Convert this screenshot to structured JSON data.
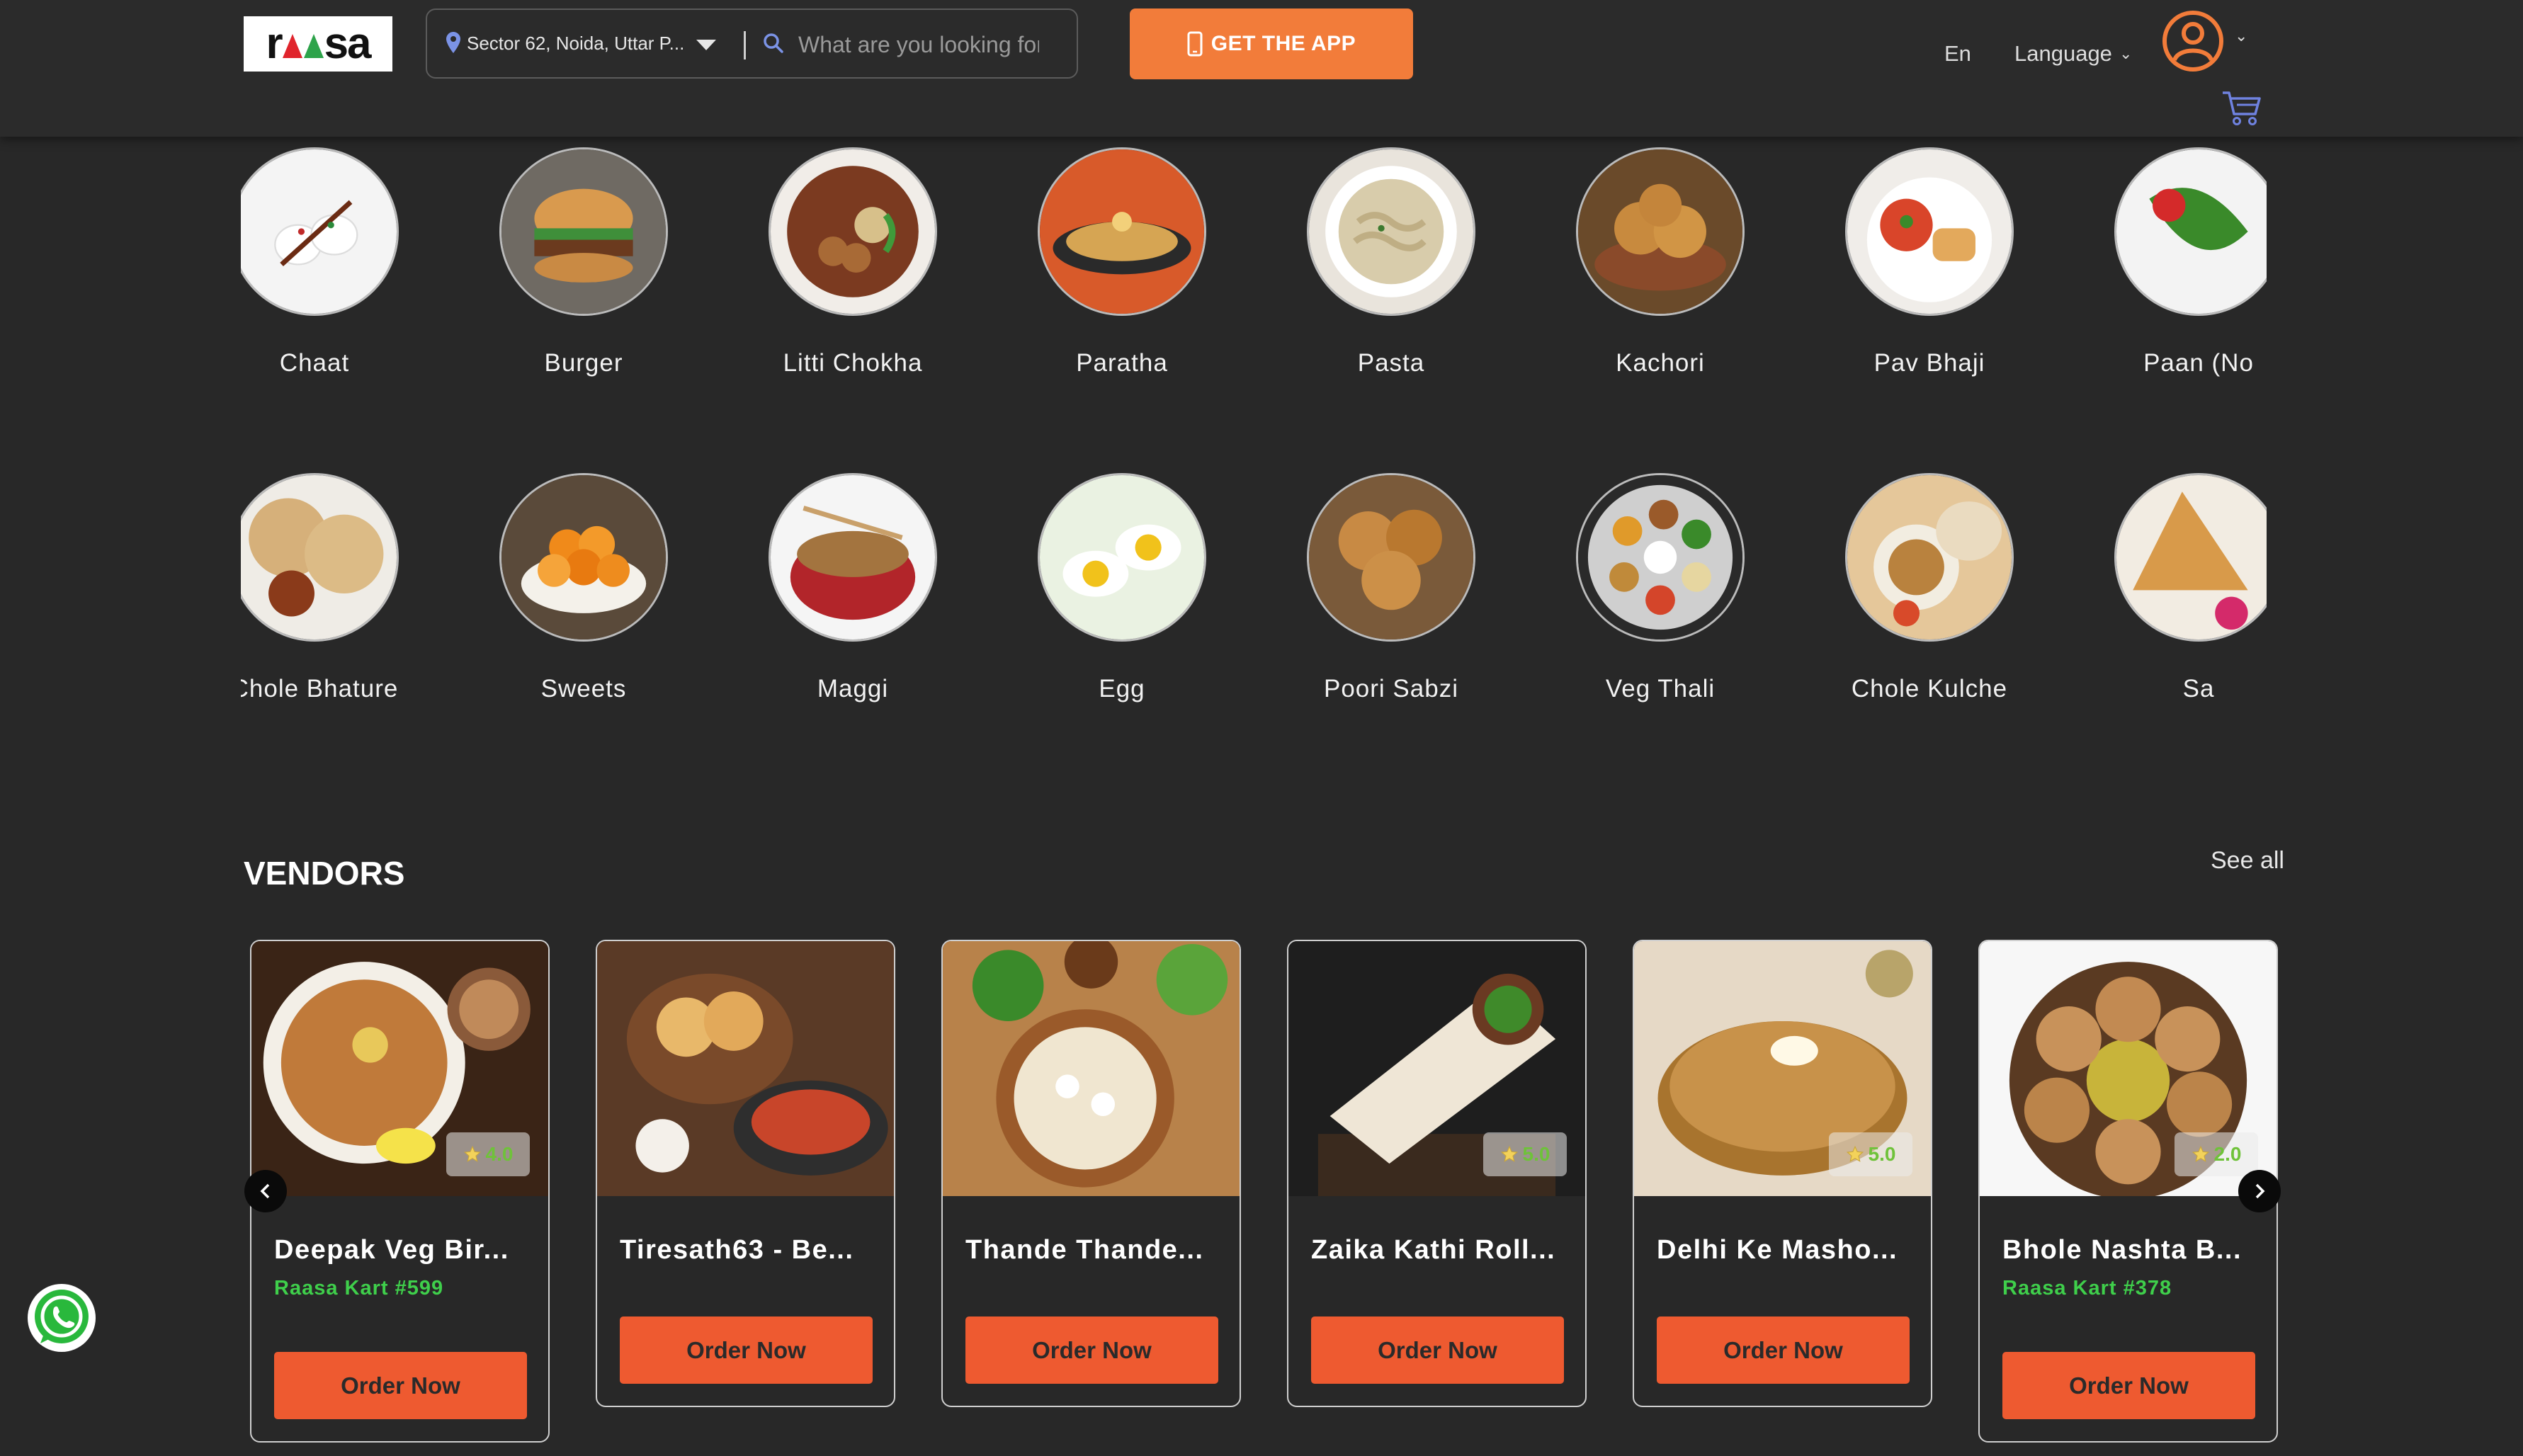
{
  "header": {
    "logo_text": "raasa",
    "location": "Sector 62, Noida, Uttar P...",
    "search_placeholder": "What are you looking for",
    "app_button": "GET THE APP",
    "lang_code": "En",
    "lang_label": "Language"
  },
  "categories": [
    {
      "label": "Chaat",
      "icon": "chaat"
    },
    {
      "label": "Burger",
      "icon": "burger"
    },
    {
      "label": "Litti Chokha",
      "icon": "litti"
    },
    {
      "label": "Paratha",
      "icon": "paratha"
    },
    {
      "label": "Pasta",
      "icon": "pasta"
    },
    {
      "label": "Kachori",
      "icon": "kachori"
    },
    {
      "label": "Pav Bhaji",
      "icon": "pavbhaji"
    },
    {
      "label": "Paan (No",
      "icon": "paan"
    },
    {
      "label": "Chole Bhature",
      "icon": "bhature"
    },
    {
      "label": "Sweets",
      "icon": "sweets"
    },
    {
      "label": "Maggi",
      "icon": "maggi"
    },
    {
      "label": "Egg",
      "icon": "egg"
    },
    {
      "label": "Poori Sabzi",
      "icon": "poori"
    },
    {
      "label": "Veg Thali",
      "icon": "thali"
    },
    {
      "label": "Chole Kulche",
      "icon": "kulche"
    },
    {
      "label": "Sa",
      "icon": "samosa"
    }
  ],
  "vendors": {
    "title": "VENDORS",
    "see_all": "See all",
    "order_label": "Order Now",
    "items": [
      {
        "name": "Deepak Veg Bir...",
        "sub": "Raasa Kart #599",
        "rating": "4.0",
        "img": "biryani"
      },
      {
        "name": "Tiresath63 - Be...",
        "sub": "",
        "rating": "",
        "img": "pav"
      },
      {
        "name": "Thande Thande...",
        "sub": "",
        "rating": "",
        "img": "chaatbowl"
      },
      {
        "name": "Zaika Kathi Roll...",
        "sub": "",
        "rating": "5.0",
        "img": "roll"
      },
      {
        "name": "Delhi Ke Masho...",
        "sub": "",
        "rating": "5.0",
        "img": "parathas"
      },
      {
        "name": "Bhole Nashta B...",
        "sub": "Raasa Kart #378",
        "rating": "2.0",
        "img": "puri"
      }
    ]
  },
  "colors": {
    "background": "#282828",
    "accent_orange": "#f27c3a",
    "order_button": "#ee5a30",
    "kart_green": "#3fcf4b",
    "rating_green": "#6fc23a"
  },
  "icons": {
    "location": "map-pin-icon",
    "search": "search-icon",
    "phone": "phone-icon",
    "avatar": "user-avatar-icon",
    "cart": "cart-icon",
    "whatsapp": "whatsapp-icon",
    "prev": "chevron-left-icon",
    "next": "chevron-right-icon"
  }
}
